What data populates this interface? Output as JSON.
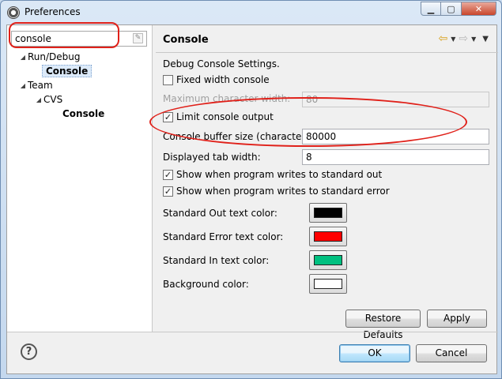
{
  "window": {
    "title": "Preferences"
  },
  "filter": {
    "value": "console"
  },
  "tree": [
    {
      "label": "Run/Debug",
      "expanded": true
    },
    {
      "label": "Console",
      "selected": true
    },
    {
      "label": "Team",
      "expanded": true
    },
    {
      "label": "CVS",
      "expanded": true
    },
    {
      "label": "Console"
    }
  ],
  "page": {
    "title": "Console",
    "section_label": "Debug Console Settings.",
    "fixed_width": {
      "label": "Fixed width console",
      "checked": false
    },
    "max_char_width": {
      "label": "Maximum character width:",
      "value": "80"
    },
    "limit_output": {
      "label": "Limit console output",
      "checked": true
    },
    "buffer_size": {
      "label": "Console buffer size (characters):",
      "value": "80000"
    },
    "tab_width": {
      "label": "Displayed tab width:",
      "value": "8"
    },
    "show_stdout": {
      "label": "Show when program writes to standard out",
      "checked": true
    },
    "show_stderr": {
      "label": "Show when program writes to standard error",
      "checked": true
    },
    "colors": [
      {
        "label": "Standard Out text color:",
        "color": "#000000"
      },
      {
        "label": "Standard Error text color:",
        "color": "#ff0000"
      },
      {
        "label": "Standard In text color:",
        "color": "#00c080"
      },
      {
        "label": "Background color:",
        "color": "#ffffff"
      }
    ],
    "restore_defaults_label": "Restore Defaults",
    "apply_label": "Apply"
  },
  "footer": {
    "ok_label": "OK",
    "cancel_label": "Cancel"
  },
  "annotation_color": "#e0211a"
}
